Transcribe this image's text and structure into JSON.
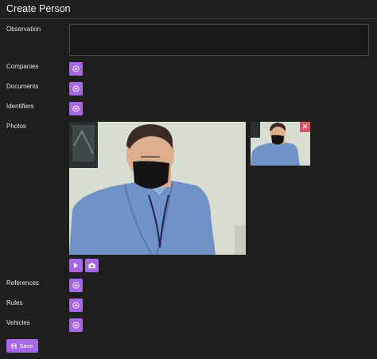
{
  "dialog": {
    "title": "Create Person"
  },
  "fields": {
    "observation": {
      "label": "Observation",
      "value": "",
      "placeholder": ""
    },
    "companies": {
      "label": "Companies"
    },
    "documents": {
      "label": "Documents"
    },
    "identifiers": {
      "label": "Identifiers"
    },
    "photos": {
      "label": "Photos"
    },
    "references": {
      "label": "References"
    },
    "rules": {
      "label": "Rules"
    },
    "vehicles": {
      "label": "Vehicles"
    }
  },
  "icons": {
    "add": "plus-circle-icon",
    "remove": "close-icon",
    "play": "play-icon",
    "camera": "camera-icon",
    "save": "save-icon"
  },
  "actions": {
    "save_label": "Save"
  },
  "colors": {
    "background": "#1e1e1e",
    "accent": "#a866e8",
    "danger": "#e05565",
    "text": "#e6e6e6",
    "border": "#4a4a4a"
  }
}
